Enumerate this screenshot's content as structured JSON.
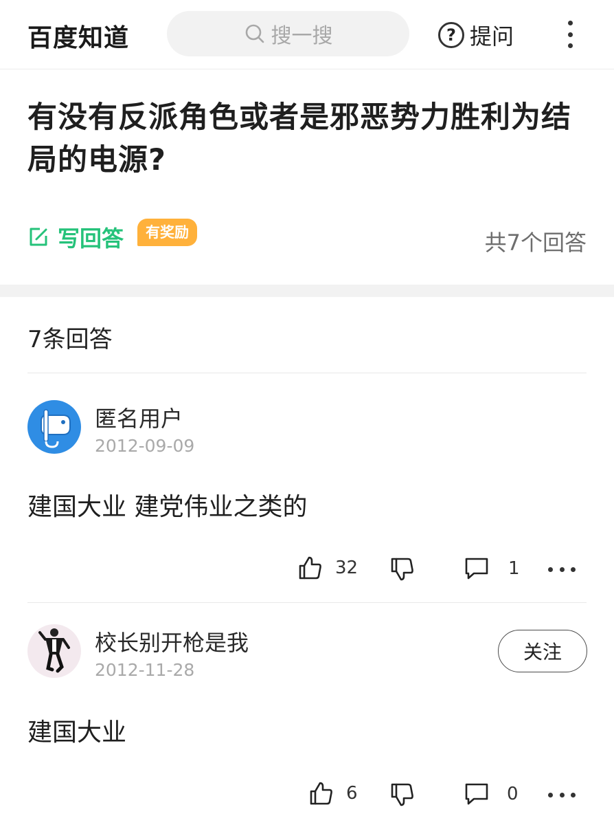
{
  "header": {
    "logo": "百度知道",
    "search_placeholder": "搜一搜",
    "ask_label": "提问"
  },
  "question": {
    "title": "有没有反派角色或者是邪恶势力胜利为结局的电源?",
    "write_label": "写回答",
    "reward_badge": "有奖励",
    "total_answers": "共7个回答"
  },
  "answers_title": "7条回答",
  "answers": [
    {
      "user": "匿名用户",
      "date": "2012-09-09",
      "text": "建国大业 建党伟业之类的",
      "likes": "32",
      "comments": "1"
    },
    {
      "user": "校长别开枪是我",
      "date": "2012-11-28",
      "text": "建国大业",
      "follow_label": "关注",
      "likes": "6",
      "comments": "0"
    }
  ],
  "colors": {
    "accent_green": "#25c27a",
    "reward_orange": "#ffb13b",
    "anon_avatar_blue": "#2f8de4"
  }
}
